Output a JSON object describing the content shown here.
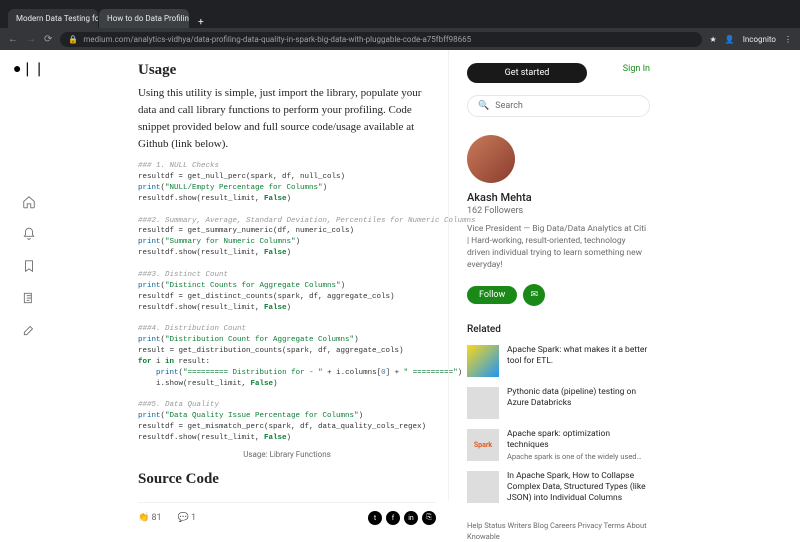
{
  "browser": {
    "tab1": "Modern Data Testing for PySp…",
    "tab2": "How to do Data Profiling/Qual…",
    "url": "medium.com/analytics-vidhya/data-profiling-data-quality-in-spark-big-data-with-pluggable-code-a75fbff98665",
    "incognito": "Incognito"
  },
  "article": {
    "h_usage": "Usage",
    "lead": "Using this utility is simple, just import the library, populate your data and call library functions to perform your profiling. Code snippet provided below and full source code/usage available at Github (link below).",
    "cap": "Usage: Library Functions",
    "h_source": "Source Code",
    "claps": "81",
    "comments": "1"
  },
  "code": {
    "c1a": "### 1. NULL Checks",
    "c1b": "resultdf = get_null_perc(spark, df, null_cols)",
    "c1c": "\"NULL/Empty Percentage for Columns\"",
    "c1d": "resultdf.show(result_limit, ",
    "c2a": "###2. Summary, Average, Standard Deviation, Percentiles for Numeric Columns",
    "c2b": "resultdf = get_summary_numeric(df, numeric_cols)",
    "c2c": "\"Summary for Numeric Columns\"",
    "c3a": "###3. Distinct Count",
    "c3b": "\"Distinct Counts for Aggregate Columns\"",
    "c3c": "resultdf = get_distinct_counts(spark, df, aggregate_cols)",
    "c4a": "###4. Distribution Count",
    "c4b": "\"Distribution Count for Aggregate Columns\"",
    "c4c": "result = get_distribution_counts(spark, df, aggregate_cols)",
    "c4d": " i ",
    "c4e": " result:",
    "c4f": "\"========= Distribution for - \"",
    "c4g": " + i.columns[",
    "c4h": "] + ",
    "c4i": "\" =========\"",
    "c4j": "    i.show(result_limit, ",
    "c5a": "###5. Data Quality",
    "c5b": "\"Data Quality Issue Percentage for Columns\"",
    "c5c": "resultdf = get_mismatch_perc(spark, df, data_quality_cols_regex)",
    "false": "False",
    "print": "print",
    "for": "for",
    "in": "in",
    "zero": "0",
    "paren": ")"
  },
  "sidebar": {
    "getstarted": "Get started",
    "signin": "Sign In",
    "search": "Search",
    "author": "Akash Mehta",
    "followers": "162 Followers",
    "bio": "Vice President — Big Data/Data Analytics at Citi | Hard-working, result-oriented, technology driven individual trying to learn something new everyday!",
    "follow": "Follow",
    "related": "Related",
    "r1t": "Apache Spark: what makes it a better tool for ETL.",
    "r2t": "Pythonic data (pipeline) testing on Azure Databricks",
    "r3t": "Apache spark: optimization techniques",
    "r3s": "Apache spark is one of the widely used…",
    "r4t": "In Apache Spark, How to Collapse Complex Data, Structured Types (like JSON) into Individual Columns",
    "spark": "Spark",
    "footer": "Help Status Writers Blog Careers Privacy Terms About Knowable"
  }
}
